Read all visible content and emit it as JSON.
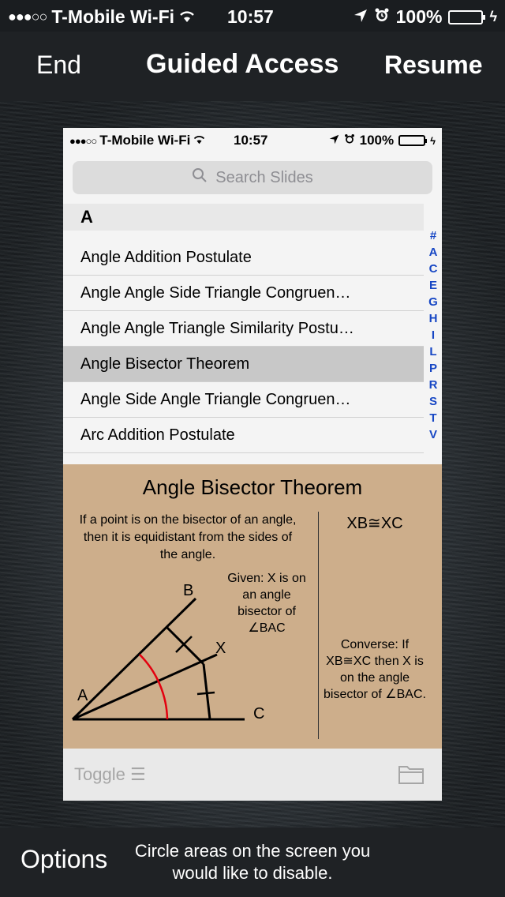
{
  "status_bar": {
    "carrier": "T-Mobile Wi-Fi",
    "time": "10:57",
    "battery": "100%"
  },
  "guided_access": {
    "end_label": "End",
    "title": "Guided Access",
    "resume_label": "Resume",
    "options_label": "Options",
    "hint": "Circle areas on the screen you would like to disable."
  },
  "inner": {
    "status_bar": {
      "carrier": "T-Mobile Wi-Fi",
      "time": "10:57",
      "battery": "100%"
    },
    "search_placeholder": "Search Slides",
    "section_header": "A",
    "list_items": [
      "Angle Addition Postulate",
      "Angle Angle Side Triangle Congruen…",
      "Angle Angle Triangle Similarity Postu…",
      "Angle Bisector Theorem",
      "Angle Side Angle Triangle Congruen…",
      "Arc Addition Postulate"
    ],
    "index_letters": [
      "#",
      "A",
      "C",
      "E",
      "G",
      "H",
      "I",
      "L",
      "P",
      "R",
      "S",
      "T",
      "V"
    ],
    "slide": {
      "title": "Angle Bisector Theorem",
      "definition": "If a point is on the bisector of an angle, then it is equidistant from the sides of the angle.",
      "conclusion": "XB≅XC",
      "given": "Given: X is on an angle bisector of ∠BAC",
      "converse": "Converse: If XB≅XC then X is on the angle bisector of ∠BAC.",
      "labels": {
        "b": "B",
        "x": "X",
        "a": "A",
        "c": "C"
      }
    },
    "toolbar": {
      "toggle_label": "Toggle ☰"
    }
  },
  "colors": {
    "slide_bg": "#cdae8b",
    "index_blue": "#1646c4",
    "battery_green": "#4cd964",
    "arc_red": "#e3000f"
  }
}
